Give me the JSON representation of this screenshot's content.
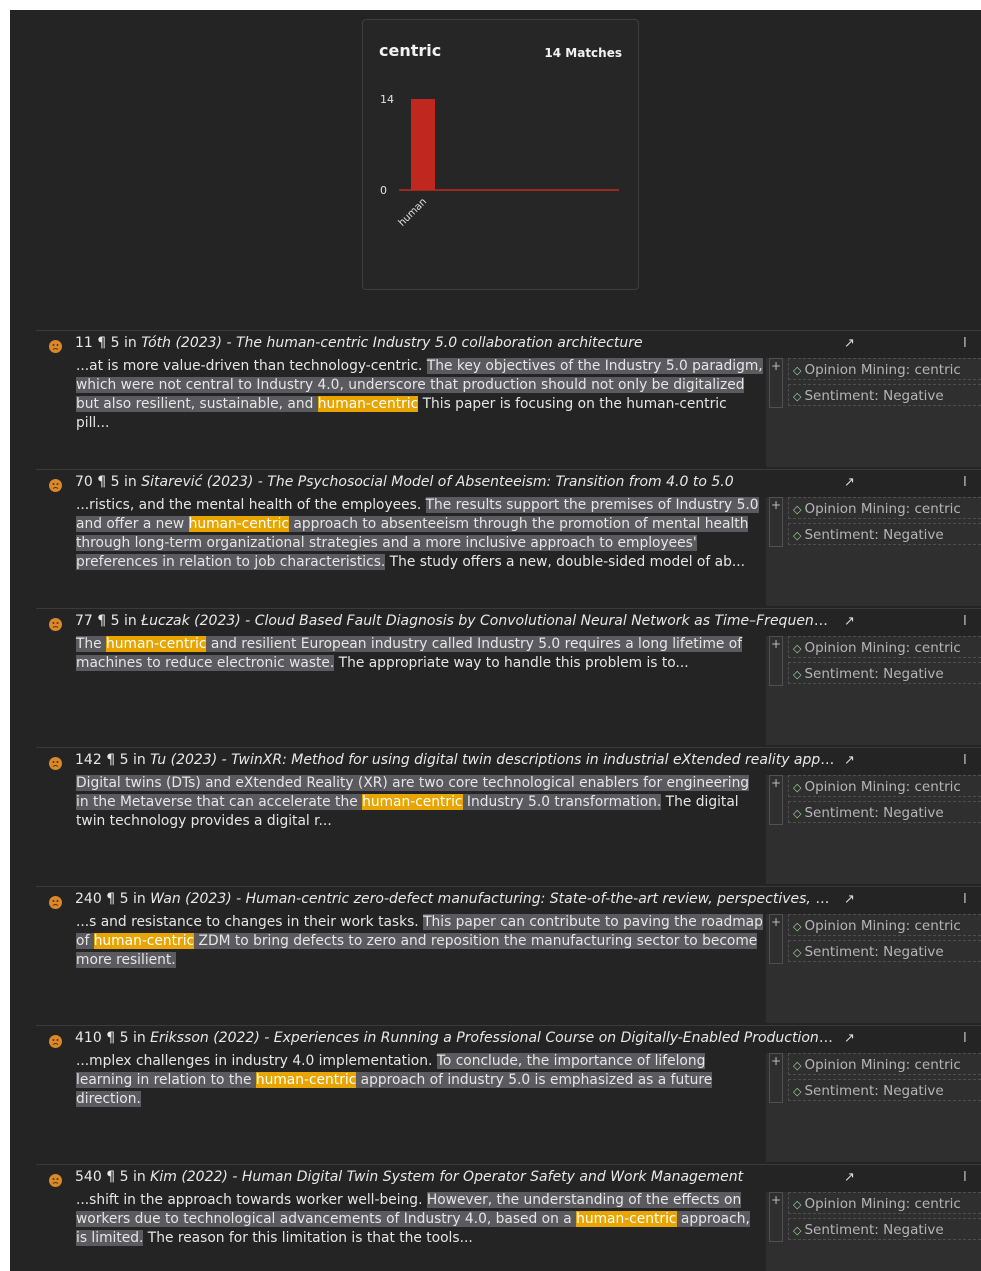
{
  "chart_card": {
    "title": "centric",
    "matches_label": "14 Matches"
  },
  "chart_data": {
    "type": "bar",
    "title": "centric",
    "categories": [
      "human"
    ],
    "values": [
      14
    ],
    "ylim": [
      0,
      14
    ],
    "yticks": [
      "14",
      "0"
    ],
    "bar_color": "#c0281f"
  },
  "tag_labels": {
    "opinion": "Opinion Mining: centric",
    "sentiment": "Sentiment: Negative",
    "plus": "+",
    "open_arrow": "↗",
    "edge": "I"
  },
  "results": [
    {
      "doc": "11",
      "para_mark": "¶",
      "para": "5",
      "in": "in",
      "author": "Tóth (2023)",
      "title": "The human-centric Industry 5.0 collaboration architecture",
      "segments": [
        {
          "t": "...at is more value-driven than technology-centric. ",
          "c": "plain"
        },
        {
          "t": "The key objectives of the Industry 5.0 paradigm, which were not central to Industry 4.0, underscore that production should not only be digitalized but also resilient, sustainable, and ",
          "c": "sel"
        },
        {
          "t": "human-centric",
          "c": "hl"
        },
        {
          "t": " This paper is focusing on the human-centric pill...",
          "c": "plain"
        }
      ]
    },
    {
      "doc": "70",
      "para_mark": "¶",
      "para": "5",
      "in": "in",
      "author": "Sitarević (2023)",
      "title": "The Psychosocial Model of Absenteeism: Transition from 4.0 to 5.0",
      "segments": [
        {
          "t": "...ristics, and the mental health of the employees. ",
          "c": "plain"
        },
        {
          "t": "The results support the premises of Industry 5.0 and offer a new ",
          "c": "sel"
        },
        {
          "t": "human-centric",
          "c": "hl"
        },
        {
          "t": " approach to absenteeism through the promotion of mental health through long-term organizational strategies and a more inclusive approach to employees' preferences in relation to job characteristics.",
          "c": "sel"
        },
        {
          "t": " The study offers a new, double-sided model of ab...",
          "c": "plain"
        }
      ]
    },
    {
      "doc": "77",
      "para_mark": "¶",
      "para": "5",
      "in": "in",
      "author": "Łuczak (2023)",
      "title": "Cloud Based Fault Diagnosis by Convolutional Neural Network as Time–Frequency RGB Image Recognition of Industrial Machine Vibration with Internet of Things Connectivity",
      "segments": [
        {
          "t": "The ",
          "c": "sel"
        },
        {
          "t": "human-centric",
          "c": "hl"
        },
        {
          "t": " and resilient European industry called Industry 5.0 requires a long lifetime of machines to reduce electronic waste.",
          "c": "sel"
        },
        {
          "t": " The appropriate way to handle this problem is to...",
          "c": "plain"
        }
      ]
    },
    {
      "doc": "142",
      "para_mark": "¶",
      "para": "5",
      "in": "in",
      "author": "Tu (2023)",
      "title": "TwinXR: Method for using digital twin descriptions in industrial eXtended reality applications",
      "segments": [
        {
          "t": "Digital twins (DTs) and eXtended Reality (XR) are two core technological enablers for engineering in the Metaverse that can accelerate the ",
          "c": "sel"
        },
        {
          "t": "human-centric",
          "c": "hl"
        },
        {
          "t": " Industry 5.0 transformation.",
          "c": "sel"
        },
        {
          "t": " The digital twin technology provides a digital r...",
          "c": "plain"
        }
      ]
    },
    {
      "doc": "240",
      "para_mark": "¶",
      "para": "5",
      "in": "in",
      "author": "Wan (2023)",
      "title": "Human-centric zero-defect manufacturing: State-of-the-art review, perspectives, and challenges",
      "segments": [
        {
          "t": "...s and resistance to changes in their work tasks. ",
          "c": "plain"
        },
        {
          "t": "This paper can contribute to paving the roadmap of ",
          "c": "sel"
        },
        {
          "t": "human-centric",
          "c": "hl"
        },
        {
          "t": " ZDM to bring defects to zero and reposition the manufacturing sector to become more resilient.",
          "c": "sel"
        }
      ]
    },
    {
      "doc": "410",
      "para_mark": "¶",
      "para": "5",
      "in": "in",
      "author": "Eriksson (2022)",
      "title": "Experiences in Running a Professional Course on Digitally-Enabled Production in Collaboration with Industry",
      "segments": [
        {
          "t": "...mplex challenges in industry 4.0 implementation. ",
          "c": "plain"
        },
        {
          "t": "To conclude, the importance of lifelong learning in relation to the ",
          "c": "sel"
        },
        {
          "t": "human-centric",
          "c": "hl"
        },
        {
          "t": " approach of industry 5.0 is emphasized as a future direction.",
          "c": "sel"
        }
      ]
    },
    {
      "doc": "540",
      "para_mark": "¶",
      "para": "5",
      "in": "in",
      "author": "Kim (2022)",
      "title": "Human Digital Twin System for Operator Safety and Work Management",
      "segments": [
        {
          "t": "...shift in the approach towards worker well-being. ",
          "c": "plain"
        },
        {
          "t": "However, the understanding of the effects on workers due to technological advancements of Industry 4.0, based on a ",
          "c": "sel"
        },
        {
          "t": "human-centric",
          "c": "hl"
        },
        {
          "t": " approach, is limited.",
          "c": "sel"
        },
        {
          "t": " The reason for this limitation is that the tools...",
          "c": "plain"
        }
      ]
    }
  ]
}
